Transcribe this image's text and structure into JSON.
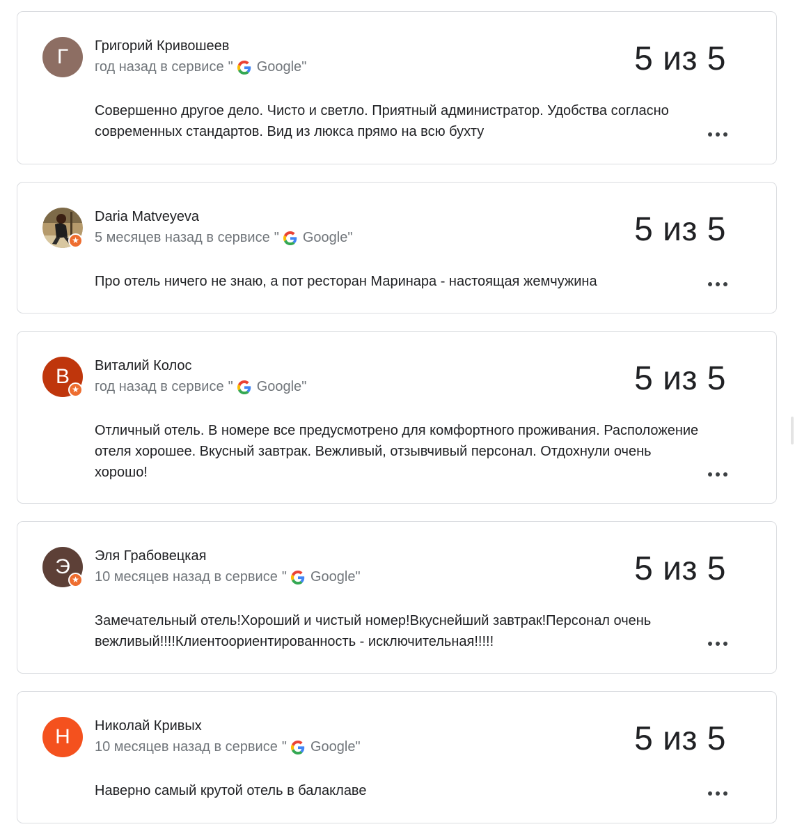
{
  "reviews": [
    {
      "author": "Григорий Кривошеев",
      "avatar_letter": "Г",
      "avatar_color": "#8d6e63",
      "has_badge": false,
      "time": "год назад в сервисе",
      "source": "Google",
      "quote_open": "\"",
      "quote_close": "\"",
      "rating": "5 из 5",
      "text": "Совершенно другое дело. Чисто и светло. Приятный администратор. Удобства согласно современных стандартов. Вид из люкса прямо на всю бухту"
    },
    {
      "author": "Daria Matveyeva",
      "avatar_letter": "",
      "avatar_color": "#6d5a3e",
      "has_badge": true,
      "time": "5 месяцев назад в сервисе",
      "source": "Google",
      "quote_open": "\"",
      "quote_close": "\"",
      "rating": "5 из 5",
      "text": "Про отель ничего не знаю, а пот ресторан Маринара - настоящая жемчужина"
    },
    {
      "author": "Виталий Колос",
      "avatar_letter": "В",
      "avatar_color": "#bf360c",
      "has_badge": true,
      "time": "год назад в сервисе",
      "source": "Google",
      "quote_open": "\"",
      "quote_close": "\"",
      "rating": "5 из 5",
      "text": "Отличный отель. В номере все предусмотрено для комфортного проживания. Расположение отеля хорошее. Вкусный завтрак. Вежливый, отзывчивый персонал. Отдохнули очень хорошо!"
    },
    {
      "author": "Эля Грабовецкая",
      "avatar_letter": "Э",
      "avatar_color": "#5d4037",
      "has_badge": true,
      "time": "10 месяцев назад в сервисе",
      "source": "Google",
      "quote_open": "\"",
      "quote_close": "\"",
      "rating": "5 из 5",
      "text": "Замечательный отель!Хороший и чистый номер!Вкуснейший завтрак!Персонал очень вежливый!!!!Клиентоориентированность - исключительная!!!!!"
    },
    {
      "author": "Николай Кривых",
      "avatar_letter": "Н",
      "avatar_color": "#f4511e",
      "has_badge": false,
      "time": "10 месяцев назад в сервисе",
      "source": "Google",
      "quote_open": "\"",
      "quote_close": "\"",
      "rating": "5 из 5",
      "text": "Наверно самый крутой отель в балаклаве"
    }
  ],
  "icons": {
    "source_icon": "google-g-icon",
    "badge_icon": "star-icon",
    "more_icon": "more-horizontal-icon"
  },
  "colors": {
    "badge": "#ee6d2f",
    "card_border": "#dadce0",
    "meta_text": "#70757a",
    "primary_text": "#202124"
  }
}
